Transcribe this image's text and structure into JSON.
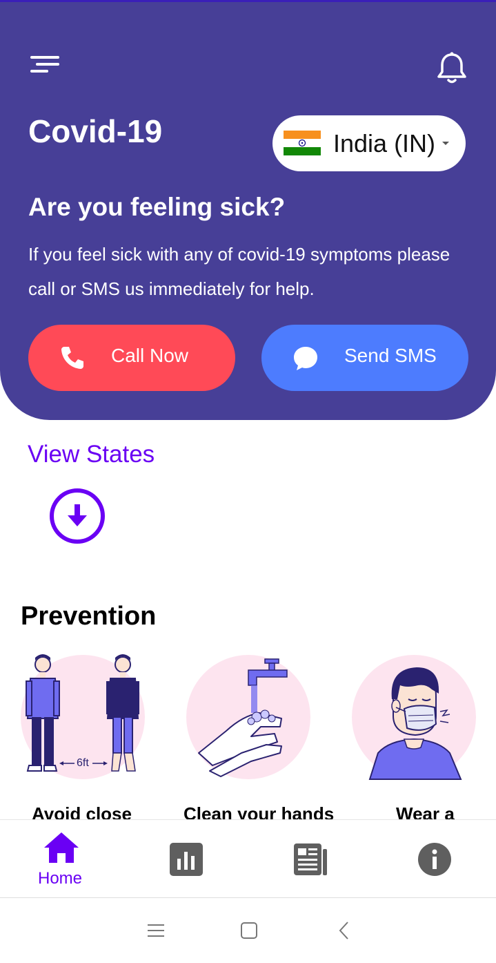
{
  "header": {
    "title": "Covid-19",
    "menu_icon": "menu-icon",
    "notification_icon": "bell-icon"
  },
  "country_select": {
    "selected": "India (IN)",
    "flag_icon": "india-flag-icon"
  },
  "sick_panel": {
    "title": "Are you feeling sick?",
    "description": "If you feel sick with any of covid-19 symptoms please call or SMS us immediately for help.",
    "call_button": "Call Now",
    "sms_button": "Send SMS"
  },
  "view_states": {
    "label": "View States",
    "icon": "arrow-down-circle-icon"
  },
  "prevention": {
    "title": "Prevention",
    "cards": [
      {
        "caption": "Avoid close",
        "illustration": "social-distance-illustration",
        "distance_label": "6ft"
      },
      {
        "caption": "Clean your hands",
        "illustration": "hand-washing-illustration"
      },
      {
        "caption": "Wear a",
        "illustration": "face-mask-illustration"
      }
    ]
  },
  "bottom_nav": {
    "items": [
      {
        "label": "Home",
        "icon": "home-icon",
        "active": true
      },
      {
        "label": "",
        "icon": "bar-chart-icon",
        "active": false
      },
      {
        "label": "",
        "icon": "news-icon",
        "active": false
      },
      {
        "label": "",
        "icon": "info-icon",
        "active": false
      }
    ]
  },
  "colors": {
    "hero_bg": "#473f97",
    "call_btn": "#ff4a57",
    "sms_btn": "#4d7cfe",
    "accent": "#6a00f4",
    "illustration_bg": "#fde4ef",
    "nav_inactive": "#5f5f5f"
  }
}
